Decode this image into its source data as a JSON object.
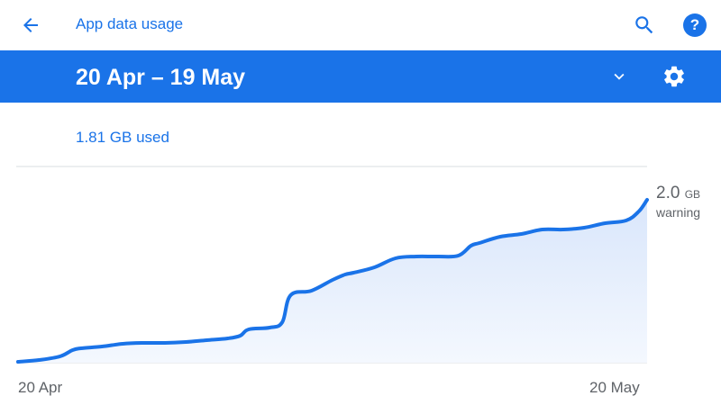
{
  "header": {
    "title": "App data usage",
    "icons": {
      "back": "arrow-back-icon",
      "search": "search-icon",
      "help": "help-icon"
    }
  },
  "cycle": {
    "date_range": "20 Apr – 19 May",
    "icons": {
      "dropdown": "chevron-down-icon",
      "settings": "gear-icon"
    }
  },
  "summary": {
    "used": "1.81 GB used"
  },
  "chart_data": {
    "type": "area",
    "x_labels": [
      "20 Apr",
      "20 May"
    ],
    "warning": {
      "value": "2.0",
      "unit": "GB",
      "label": "warning"
    },
    "y_unit": "GB",
    "ylim": [
      0,
      2.0
    ],
    "x": [
      0,
      1,
      2,
      2.6,
      3,
      4,
      5,
      6,
      7,
      8,
      9,
      10,
      10.6,
      11,
      12,
      12.6,
      13,
      14,
      15,
      15.6,
      16,
      17,
      18,
      19,
      20,
      21,
      21.6,
      22,
      23,
      24,
      25,
      26,
      27,
      28,
      29,
      29.6,
      30
    ],
    "values": [
      0.01,
      0.03,
      0.07,
      0.14,
      0.16,
      0.18,
      0.21,
      0.22,
      0.22,
      0.23,
      0.25,
      0.27,
      0.3,
      0.37,
      0.39,
      0.45,
      0.75,
      0.8,
      0.92,
      0.98,
      1.0,
      1.06,
      1.16,
      1.18,
      1.18,
      1.19,
      1.3,
      1.33,
      1.4,
      1.43,
      1.48,
      1.48,
      1.5,
      1.55,
      1.58,
      1.68,
      1.81
    ],
    "colors": {
      "line": "#1a73e8",
      "fill_top": "#d9e6fb",
      "fill_bottom": "#f4f8fe",
      "grid": "#dadce0"
    },
    "grid": false
  },
  "colors": {
    "accent": "#1a73e8",
    "secondary_text": "#5f6368"
  }
}
